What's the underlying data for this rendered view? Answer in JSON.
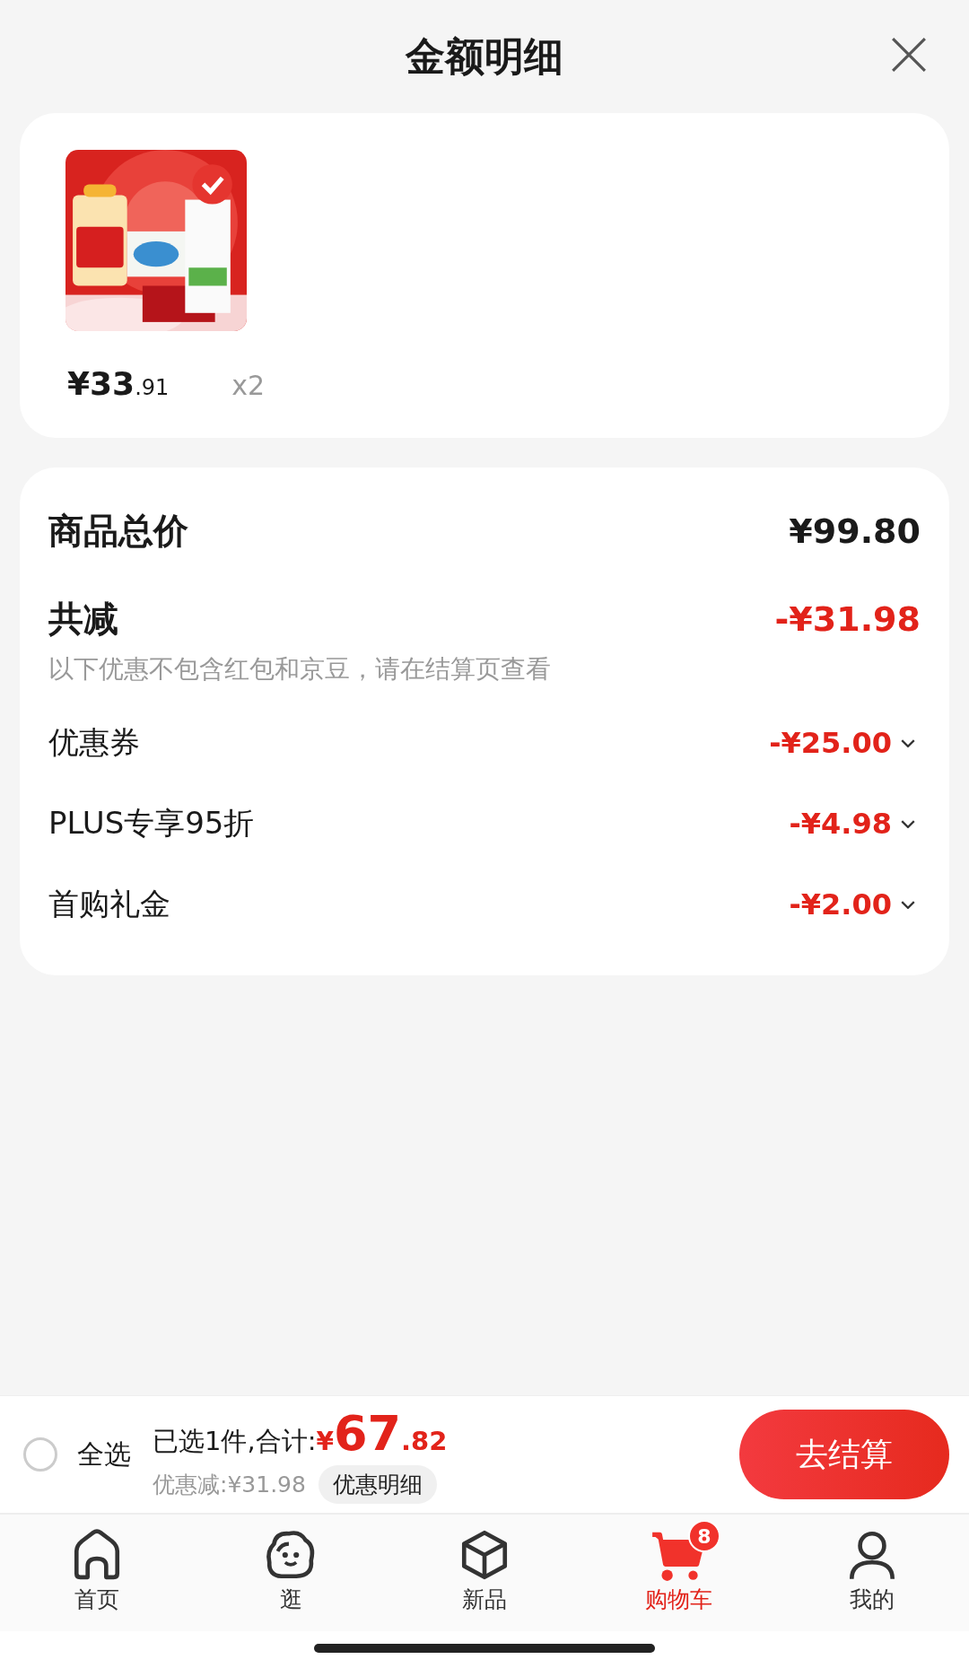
{
  "sheet": {
    "title": "金额明细"
  },
  "products": [
    {
      "kind": "picture",
      "price_main": "¥33",
      "price_decimal": ".91",
      "quantity": "x2"
    }
  ],
  "summary": {
    "total_label": "商品总价",
    "total_value": "¥99.80",
    "reduction_label": "共减",
    "reduction_value": "-¥31.98",
    "note": "以下优惠不包含红包和京豆，请在结算页查看",
    "discounts": [
      {
        "label": "优惠券",
        "value": "-¥25.00"
      },
      {
        "label": "PLUS专享95折",
        "value": "-¥4.98"
      },
      {
        "label": "首购礼金",
        "value": "-¥2.00"
      }
    ]
  },
  "checkout_bar": {
    "select_all": {
      "label": "全选",
      "checked": false
    },
    "selected_text": "已选1件,合计:",
    "currency": "¥",
    "total_main": "67",
    "total_decimal": ".82",
    "saved": "优惠减:¥31.98",
    "details_button": "优惠明细",
    "checkout_button": "去结算"
  },
  "tab_bar": [
    {
      "kind": "home",
      "label": "首页",
      "selected": false
    },
    {
      "kind": "explore",
      "label": "逛",
      "selected": false
    },
    {
      "kind": "new",
      "label": "新品",
      "selected": false
    },
    {
      "kind": "cart",
      "label": "购物车",
      "selected": true,
      "badge": "8"
    },
    {
      "kind": "profile",
      "label": "我的",
      "selected": false
    }
  ]
}
